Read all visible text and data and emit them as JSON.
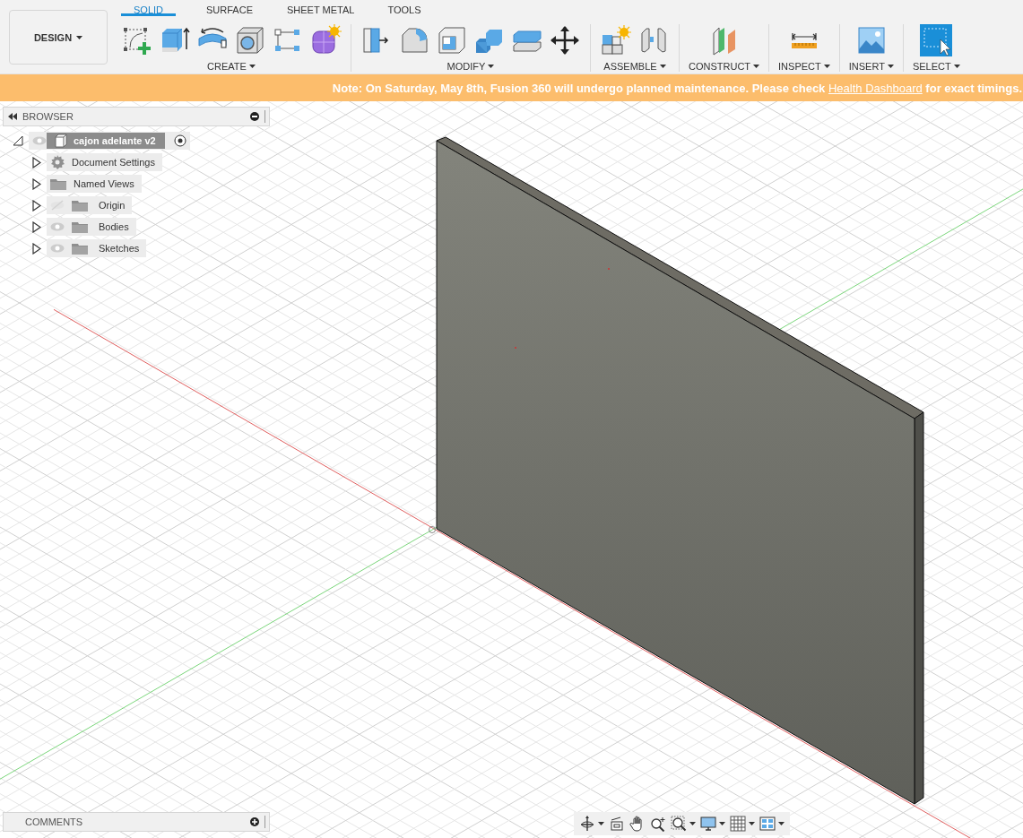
{
  "workspace": {
    "label": "DESIGN"
  },
  "tabs": [
    {
      "label": "SOLID",
      "selected": true
    },
    {
      "label": "SURFACE",
      "selected": false
    },
    {
      "label": "SHEET METAL",
      "selected": false
    },
    {
      "label": "TOOLS",
      "selected": false
    }
  ],
  "groups": [
    {
      "label": "CREATE",
      "tools": [
        {
          "kind": "sketch",
          "active": false
        },
        {
          "kind": "extrude",
          "active": false
        },
        {
          "kind": "revolve",
          "active": false
        },
        {
          "kind": "hole",
          "active": false
        },
        {
          "kind": "pattern",
          "active": false
        },
        {
          "kind": "form",
          "active": false
        }
      ]
    },
    {
      "label": "MODIFY",
      "tools": [
        {
          "kind": "press-pull",
          "active": false
        },
        {
          "kind": "fillet",
          "active": false
        },
        {
          "kind": "shell",
          "active": false
        },
        {
          "kind": "combine",
          "active": false
        },
        {
          "kind": "offset",
          "active": false
        },
        {
          "kind": "move",
          "active": false
        }
      ]
    },
    {
      "label": "ASSEMBLE",
      "tools": [
        {
          "kind": "new-component",
          "active": false
        },
        {
          "kind": "joint",
          "active": false
        }
      ]
    },
    {
      "label": "CONSTRUCT",
      "tools": [
        {
          "kind": "plane",
          "active": false
        }
      ]
    },
    {
      "label": "INSPECT",
      "tools": [
        {
          "kind": "measure",
          "active": false
        }
      ]
    },
    {
      "label": "INSERT",
      "tools": [
        {
          "kind": "image",
          "active": false
        }
      ]
    },
    {
      "label": "SELECT",
      "tools": [
        {
          "kind": "select",
          "active": true
        }
      ]
    }
  ],
  "banner": {
    "text_before": "Note: On Saturday, May 8th, Fusion 360 will undergo planned maintenance. Please check ",
    "link": "Health Dashboard",
    "text_after": " for exact timings."
  },
  "browser": {
    "title": "BROWSER",
    "root": {
      "label": "cajon adelante v2",
      "expanded": true,
      "visible": true,
      "active": true,
      "children": [
        {
          "kind": "settings",
          "label": "Document Settings",
          "expanded": false
        },
        {
          "kind": "views",
          "label": "Named Views",
          "expanded": false
        },
        {
          "kind": "folder",
          "label": "Origin",
          "expanded": false,
          "visible": false
        },
        {
          "kind": "folder",
          "label": "Bodies",
          "expanded": false,
          "visible": true
        },
        {
          "kind": "folder",
          "label": "Sketches",
          "expanded": false,
          "visible": true
        }
      ]
    }
  },
  "comments": {
    "title": "COMMENTS"
  },
  "navigation": [
    {
      "kind": "orbit",
      "menu": true
    },
    {
      "kind": "look-at",
      "menu": false
    },
    {
      "kind": "pan",
      "menu": false
    },
    {
      "kind": "zoom",
      "menu": false
    },
    {
      "kind": "fit",
      "menu": true
    },
    {
      "kind": "display",
      "menu": true
    },
    {
      "kind": "grid",
      "menu": true
    },
    {
      "kind": "viewports",
      "menu": true
    }
  ]
}
